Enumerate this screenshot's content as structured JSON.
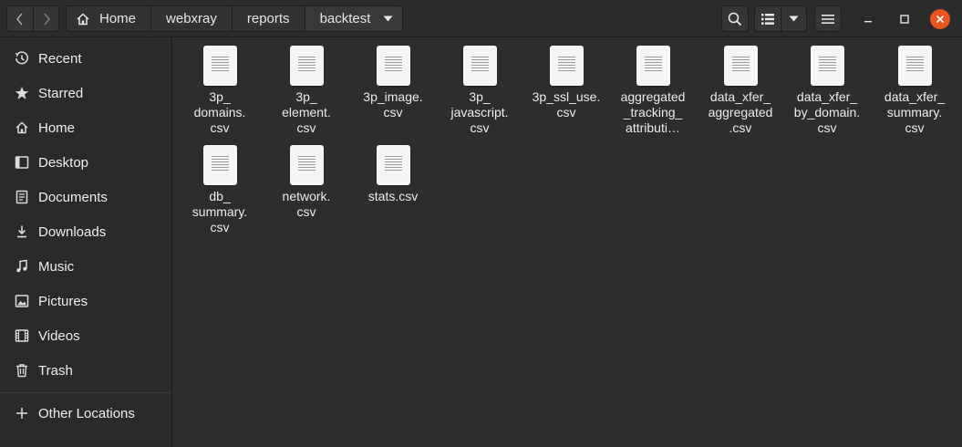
{
  "header": {
    "breadcrumbs": [
      "Home",
      "webxray",
      "reports",
      "backtest"
    ]
  },
  "sidebar": {
    "items": [
      {
        "label": "Recent",
        "icon": "clock-icon"
      },
      {
        "label": "Starred",
        "icon": "star-icon"
      },
      {
        "label": "Home",
        "icon": "home-icon"
      },
      {
        "label": "Desktop",
        "icon": "desktop-icon"
      },
      {
        "label": "Documents",
        "icon": "documents-icon"
      },
      {
        "label": "Downloads",
        "icon": "download-icon"
      },
      {
        "label": "Music",
        "icon": "music-icon"
      },
      {
        "label": "Pictures",
        "icon": "pictures-icon"
      },
      {
        "label": "Videos",
        "icon": "videos-icon"
      },
      {
        "label": "Trash",
        "icon": "trash-icon"
      }
    ],
    "other_locations": {
      "label": "Other Locations",
      "icon": "plus-icon"
    }
  },
  "files": [
    {
      "name": "3p_\ndomains.\ncsv"
    },
    {
      "name": "3p_\nelement.\ncsv"
    },
    {
      "name": "3p_image.\ncsv"
    },
    {
      "name": "3p_\njavascript.\ncsv"
    },
    {
      "name": "3p_ssl_use.\ncsv"
    },
    {
      "name": "aggregated\n_tracking_\nattributi…"
    },
    {
      "name": "data_xfer_\naggregated\n.csv"
    },
    {
      "name": "data_xfer_\nby_domain.\ncsv"
    },
    {
      "name": "data_xfer_\nsummary.\ncsv"
    },
    {
      "name": "db_\nsummary.\ncsv"
    },
    {
      "name": "network.\ncsv"
    },
    {
      "name": "stats.csv"
    }
  ],
  "colors": {
    "accent_close": "#e9541f",
    "background": "#2d2d2d",
    "sidebar": "#2a2a2a"
  }
}
